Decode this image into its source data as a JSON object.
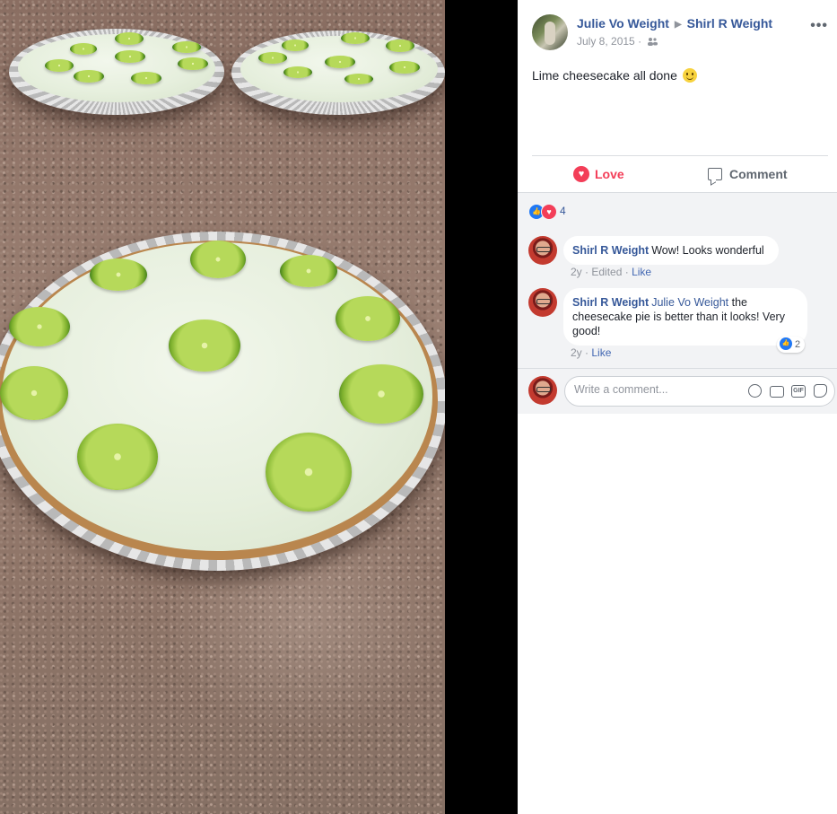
{
  "post": {
    "author": "Julie Vo Weight",
    "target": "Shirl R Weight",
    "date": "July 8, 2015",
    "audience_icon": "friends-icon",
    "caption": "Lime cheesecake all done",
    "caption_emoji": "smile-emoji"
  },
  "actions": {
    "love_label": "Love",
    "comment_label": "Comment"
  },
  "reactions": {
    "types": [
      "like",
      "love"
    ],
    "count": "4"
  },
  "comments": [
    {
      "author": "Shirl R Weight",
      "text": "Wow! Looks wonderful",
      "time": "2y",
      "edited": "Edited",
      "like_label": "Like"
    },
    {
      "author": "Shirl R Weight",
      "mention": "Julie Vo Weight",
      "text": "the cheesecake pie is better than it looks! Very good!",
      "time": "2y",
      "like_label": "Like",
      "reaction_count": "2"
    }
  ],
  "composer": {
    "placeholder": "Write a comment...",
    "tools": [
      "emoji-icon",
      "camera-icon",
      "gif-icon",
      "sticker-icon"
    ]
  },
  "colors": {
    "link": "#365899",
    "love": "#f33e58",
    "like": "#2078f4",
    "muted": "#90949c"
  }
}
